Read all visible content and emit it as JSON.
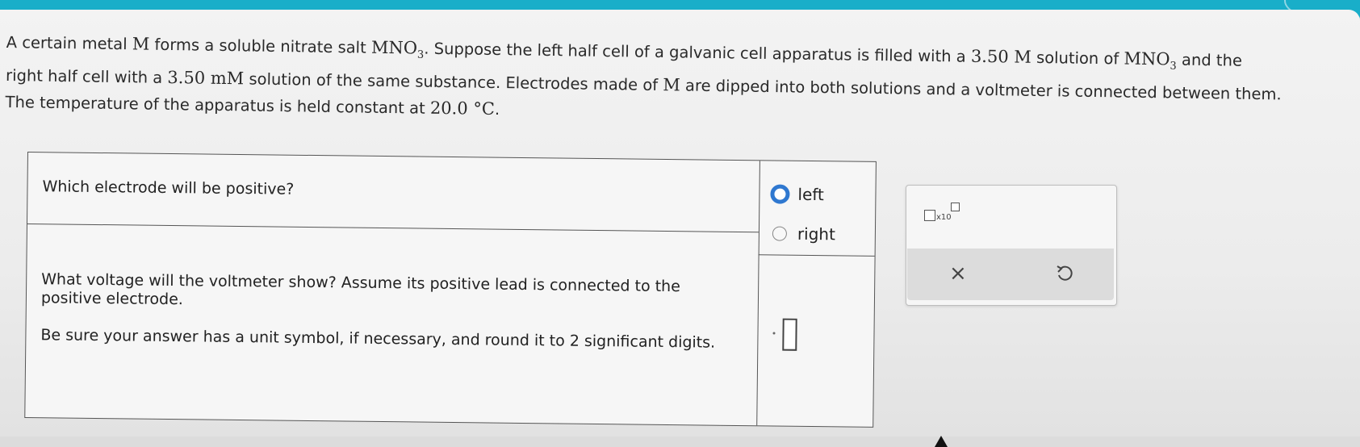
{
  "problem": {
    "line1": {
      "t1": "A certain metal ",
      "m1": "M",
      "t2": " forms a soluble nitrate salt ",
      "formula": "MNO",
      "sub": "3",
      "t3": ". Suppose the left half cell of a galvanic cell apparatus is filled with a ",
      "conc": "3.50 M",
      "t4": " solution of ",
      "formula2": "MNO",
      "sub2": "3",
      "t5": " and the"
    },
    "line2": {
      "t1": "right half cell with a ",
      "conc": "3.50 mM",
      "t2": " solution of the same substance. Electrodes made of ",
      "m1": "M",
      "t3": " are dipped into both solutions and a voltmeter is connected between them."
    },
    "line3": {
      "t1": "The temperature of the apparatus is held constant at ",
      "temp": "20.0 °C",
      "t2": "."
    }
  },
  "questions": {
    "q1": "Which electrode will be positive?",
    "q2": "What voltage will the voltmeter show? Assume its positive lead is connected to the positive electrode.",
    "q3": "Be sure your answer has a unit symbol, if necessary, and round it to 2 significant digits."
  },
  "options": {
    "left": {
      "label": "left",
      "selected": true
    },
    "right": {
      "label": "right",
      "selected": false
    }
  },
  "answer": {
    "value": ""
  },
  "toolbox": {
    "sci_label": "x10",
    "clear_icon": "×",
    "undo_icon": "undo-icon"
  },
  "colors": {
    "accent": "#2f78d0",
    "header_teal": "#19aec9"
  }
}
